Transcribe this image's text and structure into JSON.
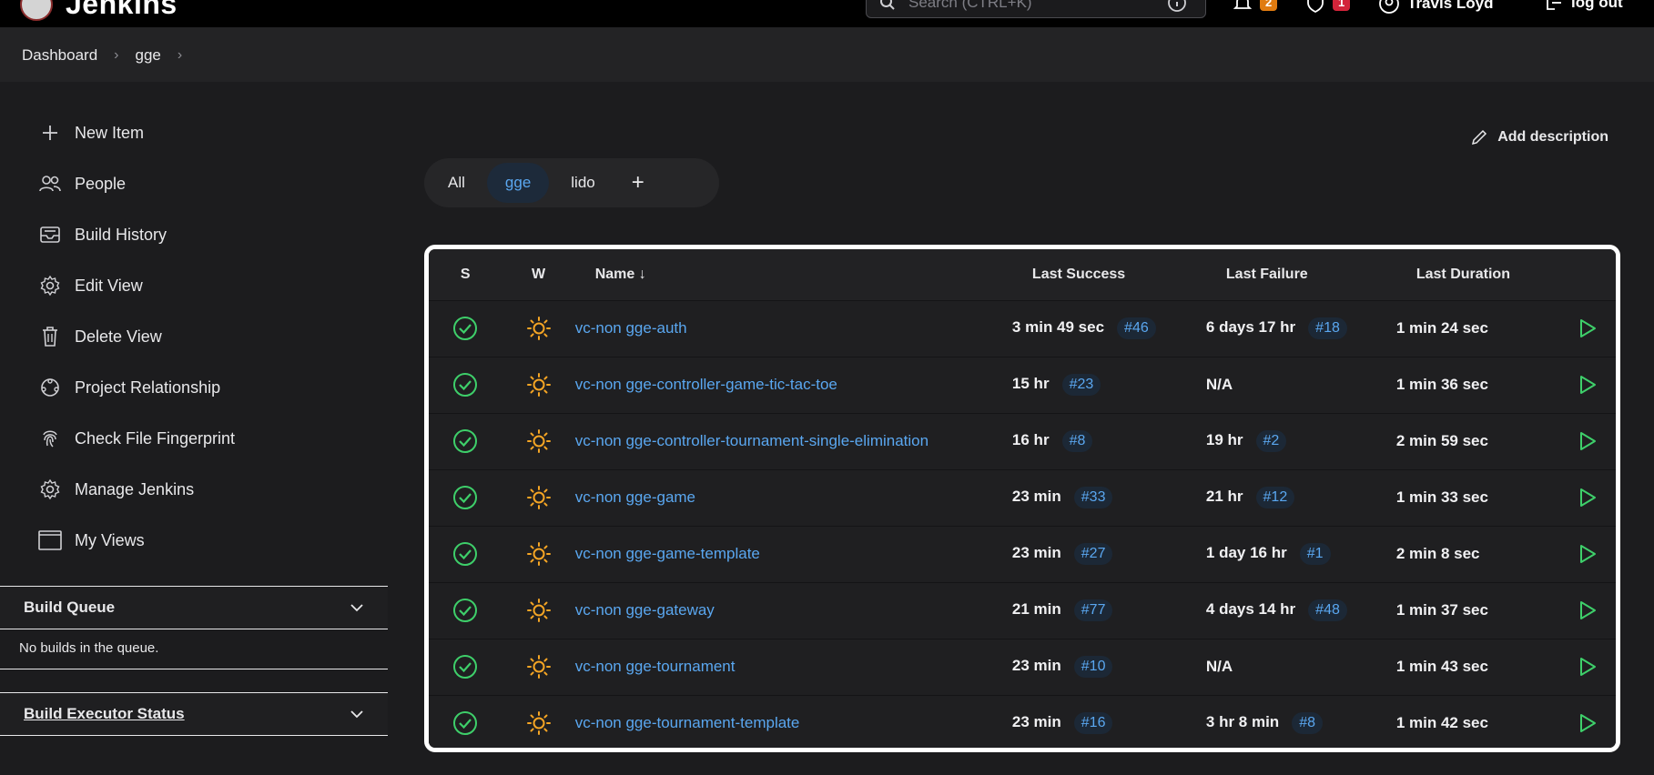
{
  "header": {
    "brand": "Jenkins",
    "search_placeholder": "Search (CTRL+K)",
    "notifications_count": "2",
    "security_count": "1",
    "user_name": "Travis Loyd",
    "logout_label": "log out",
    "colors": {
      "orange_badge": "#e07b10",
      "red_badge": "#d3243a"
    }
  },
  "breadcrumbs": [
    "Dashboard",
    "gge"
  ],
  "sidebar": {
    "items": [
      {
        "label": "New Item",
        "icon": "plus-icon"
      },
      {
        "label": "People",
        "icon": "people-icon"
      },
      {
        "label": "Build History",
        "icon": "inbox-icon"
      },
      {
        "label": "Edit View",
        "icon": "gear-icon"
      },
      {
        "label": "Delete View",
        "icon": "trash-icon"
      },
      {
        "label": "Project Relationship",
        "icon": "relationship-icon"
      },
      {
        "label": "Check File Fingerprint",
        "icon": "fingerprint-icon"
      },
      {
        "label": "Manage Jenkins",
        "icon": "gear-icon"
      },
      {
        "label": "My Views",
        "icon": "window-icon"
      }
    ],
    "build_queue": {
      "title": "Build Queue",
      "empty_text": "No builds in the queue."
    },
    "build_executor": {
      "title": "Build Executor Status"
    }
  },
  "main": {
    "add_description": "Add description",
    "tabs": [
      {
        "label": "All",
        "active": false
      },
      {
        "label": "gge",
        "active": true
      },
      {
        "label": "lido",
        "active": false
      }
    ],
    "add_tab_label": "+",
    "table": {
      "headers": {
        "s": "S",
        "w": "W",
        "name": "Name ↓",
        "last_success": "Last Success",
        "last_failure": "Last Failure",
        "last_duration": "Last Duration"
      },
      "rows": [
        {
          "name": "vc-non gge-auth",
          "ls_time": "3 min 49 sec",
          "ls_build": "#46",
          "lf_time": "6 days 17 hr",
          "lf_build": "#18",
          "duration": "1 min 24 sec"
        },
        {
          "name": "vc-non gge-controller-game-tic-tac-toe",
          "ls_time": "15 hr",
          "ls_build": "#23",
          "lf_time": "N/A",
          "lf_build": "",
          "duration": "1 min 36 sec"
        },
        {
          "name": "vc-non gge-controller-tournament-single-elimination",
          "ls_time": "16 hr",
          "ls_build": "#8",
          "lf_time": "19 hr",
          "lf_build": "#2",
          "duration": "2 min 59 sec"
        },
        {
          "name": "vc-non gge-game",
          "ls_time": "23 min",
          "ls_build": "#33",
          "lf_time": "21 hr",
          "lf_build": "#12",
          "duration": "1 min 33 sec"
        },
        {
          "name": "vc-non gge-game-template",
          "ls_time": "23 min",
          "ls_build": "#27",
          "lf_time": "1 day 16 hr",
          "lf_build": "#1",
          "duration": "2 min 8 sec"
        },
        {
          "name": "vc-non gge-gateway",
          "ls_time": "21 min",
          "ls_build": "#77",
          "lf_time": "4 days 14 hr",
          "lf_build": "#48",
          "duration": "1 min 37 sec"
        },
        {
          "name": "vc-non gge-tournament",
          "ls_time": "23 min",
          "ls_build": "#10",
          "lf_time": "N/A",
          "lf_build": "",
          "duration": "1 min 43 sec"
        },
        {
          "name": "vc-non gge-tournament-template",
          "ls_time": "23 min",
          "ls_build": "#16",
          "lf_time": "3 hr 8 min",
          "lf_build": "#8",
          "duration": "1 min 42 sec"
        }
      ],
      "colors": {
        "success": "#3ecf6a",
        "weather": "#f5a524",
        "link": "#5aa7f0"
      }
    }
  }
}
